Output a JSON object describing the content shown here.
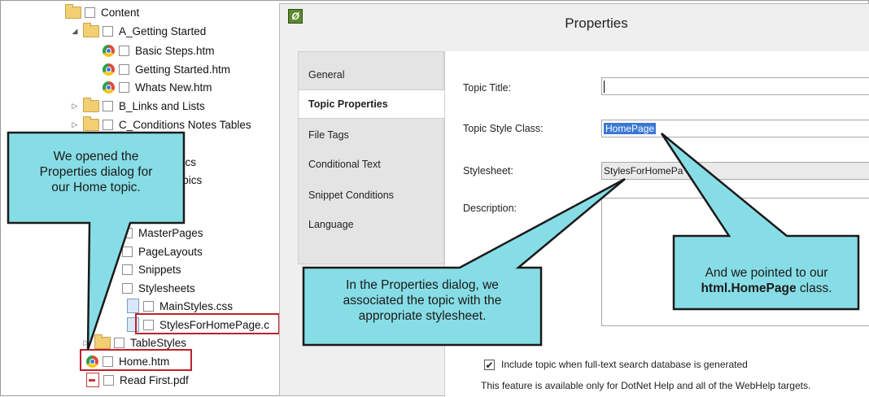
{
  "tree": {
    "items": [
      {
        "label": "Content",
        "kind": "folder",
        "expander": ""
      },
      {
        "label": "A_Getting Started",
        "kind": "folder",
        "expander": "◢"
      },
      {
        "label": "Basic Steps.htm",
        "kind": "chrome",
        "expander": ""
      },
      {
        "label": "Getting Started.htm",
        "kind": "chrome",
        "expander": ""
      },
      {
        "label": "Whats New.htm",
        "kind": "chrome",
        "expander": ""
      },
      {
        "label": "B_Links and Lists",
        "kind": "folder",
        "expander": "▷"
      },
      {
        "label": "C_Conditions Notes Tables",
        "kind": "folder",
        "expander": "▷"
      },
      {
        "label": "pics",
        "kind": "text",
        "expander": ""
      },
      {
        "label": "Topics",
        "kind": "text",
        "expander": ""
      },
      {
        "label": "MasterPages",
        "kind": "folder",
        "expander": ""
      },
      {
        "label": "PageLayouts",
        "kind": "folder",
        "expander": ""
      },
      {
        "label": "Snippets",
        "kind": "folder",
        "expander": "▷"
      },
      {
        "label": "Stylesheets",
        "kind": "folder",
        "expander": "◢"
      },
      {
        "label": "MainStyles.css",
        "kind": "css",
        "expander": ""
      },
      {
        "label": "StylesForHomePage.c",
        "kind": "css",
        "expander": ""
      },
      {
        "label": "TableStyles",
        "kind": "folder",
        "expander": "▷"
      },
      {
        "label": "Home.htm",
        "kind": "chrome",
        "expander": ""
      },
      {
        "label": "Read First.pdf",
        "kind": "pdf",
        "expander": ""
      }
    ]
  },
  "dialog": {
    "title": "Properties",
    "app_icon": "Ø",
    "tabs": [
      "General",
      "Topic Properties",
      "File Tags",
      "Conditional Text",
      "Snippet Conditions",
      "Language"
    ],
    "active_tab": "Topic Properties",
    "fields": {
      "topic_title_label": "Topic Title:",
      "topic_title_value": "",
      "style_class_label": "Topic Style Class:",
      "style_class_value": "HomePage",
      "stylesheet_label": "Stylesheet:",
      "stylesheet_value": "StylesForHomePa",
      "description_label": "Description:"
    },
    "include_checkbox_label": "Include topic when full-text search database is generated",
    "include_checked": true,
    "note": "This feature is available only for DotNet Help and all of the WebHelp targets."
  },
  "callouts": {
    "left": [
      "We opened the",
      "Properties dialog for",
      "our Home topic."
    ],
    "middle": [
      "In the Properties dialog, we",
      "associated the topic with the",
      "appropriate stylesheet."
    ],
    "right_line1": "And we pointed to our",
    "right_bold": "html.HomePage",
    "right_suffix": " class."
  },
  "colors": {
    "callout_fill": "#87dde6",
    "callout_border": "#1a1a1a",
    "highlight_red": "#c0202a",
    "selection_blue": "#3b78d6"
  }
}
